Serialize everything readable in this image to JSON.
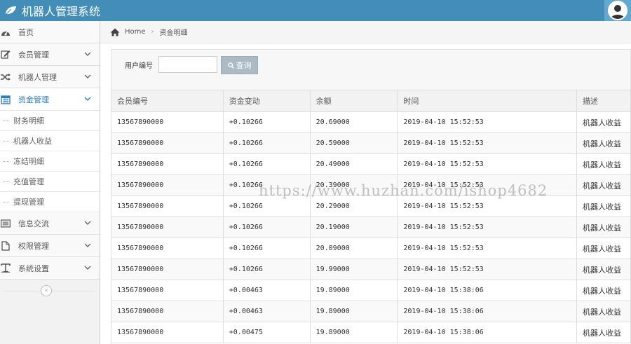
{
  "app": {
    "title": "机器人管理系统"
  },
  "sidebar": {
    "items": [
      {
        "label": "首页",
        "icon": "dashboard-icon"
      },
      {
        "label": "会员管理",
        "icon": "edit-icon"
      },
      {
        "label": "机器人管理",
        "icon": "shuffle-icon"
      },
      {
        "label": "资金管理",
        "icon": "calendar-icon",
        "active": true
      },
      {
        "label": "信息交流",
        "icon": "list-icon"
      },
      {
        "label": "权限管理",
        "icon": "file-icon"
      },
      {
        "label": "系统设置",
        "icon": "text-icon"
      }
    ],
    "sub_items": [
      "财务明细",
      "机器人收益",
      "冻结明细",
      "充值管理",
      "提现管理"
    ],
    "collapse_glyph": "«"
  },
  "breadcrumb": {
    "home": "Home",
    "current": "资金明细"
  },
  "search": {
    "label": "用户编号",
    "value": "",
    "button": "查询"
  },
  "table": {
    "headers": [
      "会员编号",
      "资金变动",
      "余额",
      "时间",
      "描述"
    ],
    "rows": [
      [
        "13567890000",
        "+0.10266",
        "20.69000",
        "2019-04-10 15:52:53",
        "机器人收益"
      ],
      [
        "13567890000",
        "+0.10266",
        "20.59000",
        "2019-04-10 15:52:53",
        "机器人收益"
      ],
      [
        "13567890000",
        "+0.10266",
        "20.49000",
        "2019-04-10 15:52:53",
        "机器人收益"
      ],
      [
        "13567890000",
        "+0.10266",
        "20.39000",
        "2019-04-10 15:52:53",
        "机器人收益"
      ],
      [
        "13567890000",
        "+0.10266",
        "20.29000",
        "2019-04-10 15:52:53",
        "机器人收益"
      ],
      [
        "13567890000",
        "+0.10266",
        "20.19000",
        "2019-04-10 15:52:53",
        "机器人收益"
      ],
      [
        "13567890000",
        "+0.10266",
        "20.09000",
        "2019-04-10 15:52:53",
        "机器人收益"
      ],
      [
        "13567890000",
        "+0.10266",
        "19.99000",
        "2019-04-10 15:52:53",
        "机器人收益"
      ],
      [
        "13567890000",
        "+0.00463",
        "19.89000",
        "2019-04-10 15:38:06",
        "机器人收益"
      ],
      [
        "13567890000",
        "+0.00463",
        "19.89000",
        "2019-04-10 15:38:06",
        "机器人收益"
      ],
      [
        "13567890000",
        "+0.00475",
        "19.89000",
        "2019-04-10 15:38:06",
        "机器人收益"
      ]
    ]
  },
  "watermark": "https://www.huzhan.com/ishop4682",
  "colors": {
    "header": "#438eb9",
    "accent": "#2b7dbc",
    "button": "#abbac3"
  }
}
